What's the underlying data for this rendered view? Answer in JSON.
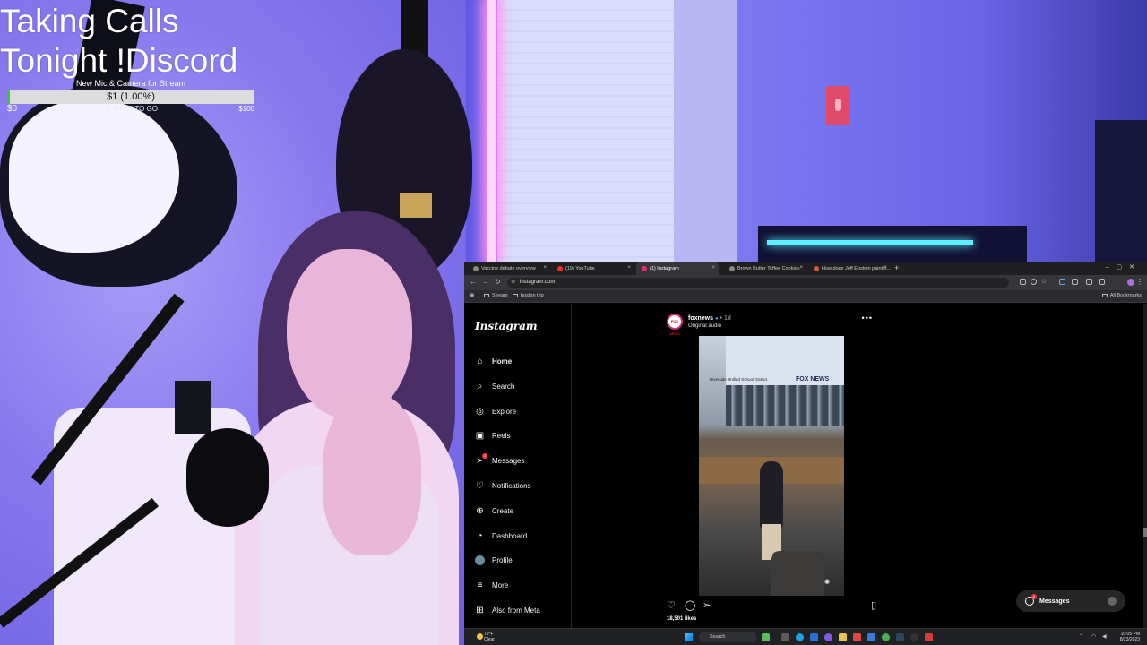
{
  "overlay": {
    "title_line1": "Taking Calls",
    "title_line2": "Tonight !Discord",
    "goal": {
      "label": "New Mic & Camera for Stream",
      "current_text": "$1 (1.00%)",
      "progress_pct": 1.0,
      "start": "$0",
      "days_left": "17 DAYS TO GO",
      "end": "$100",
      "fill_color": "#37c44b"
    }
  },
  "browser": {
    "tabs": [
      {
        "label": "Vaccine debate overview",
        "icon": "globe-icon",
        "active": false
      },
      {
        "label": "(19) YouTube",
        "icon": "youtube-icon",
        "active": false
      },
      {
        "label": "(1) Instagram",
        "icon": "instagram-icon",
        "active": true
      },
      {
        "label": "Brown Butter Toffee Cookies",
        "icon": "globe-icon",
        "active": false
      },
      {
        "label": "How does Jeff Epstein paintin...",
        "icon": "globe-icon",
        "active": false
      }
    ],
    "new_tab": "+",
    "url": "instagram.com",
    "bookmarks": [
      "Stream",
      "boston trip"
    ],
    "all_bookmarks": "All Bookmarks"
  },
  "instagram": {
    "logo": "Instagram",
    "nav": [
      {
        "label": "Home",
        "icon": "home-icon",
        "active": true,
        "badge": ""
      },
      {
        "label": "Search",
        "icon": "search-icon",
        "active": false,
        "badge": ""
      },
      {
        "label": "Explore",
        "icon": "compass-icon",
        "active": false,
        "badge": ""
      },
      {
        "label": "Reels",
        "icon": "reels-icon",
        "active": false,
        "badge": ""
      },
      {
        "label": "Messages",
        "icon": "messenger-icon",
        "active": false,
        "badge": "1"
      },
      {
        "label": "Notifications",
        "icon": "heart-icon",
        "active": false,
        "badge": ""
      },
      {
        "label": "Create",
        "icon": "plus-square-icon",
        "active": false,
        "badge": ""
      },
      {
        "label": "Dashboard",
        "icon": "dashboard-icon",
        "active": false,
        "badge": ""
      },
      {
        "label": "Profile",
        "icon": "profile-avatar-icon",
        "active": false,
        "badge": ""
      },
      {
        "label": "More",
        "icon": "menu-icon",
        "active": false,
        "badge": ""
      },
      {
        "label": "Also from Meta",
        "icon": "meta-icon",
        "active": false,
        "badge": ""
      }
    ],
    "post": {
      "avatar_text": "FOX NEWS",
      "username": "foxnews",
      "verified": "●",
      "time": "• 1d",
      "audio": "Original audio",
      "video_caption": "Riverside Unified School District",
      "video_logo": "FOX NEWS",
      "likes": "18,501 likes"
    },
    "messages_pill": {
      "label": "Messages",
      "badge": "1"
    }
  },
  "taskbar": {
    "weather_temp": "79°F",
    "weather_desc": "Clear",
    "search_placeholder": "Search",
    "time": "10:05 PM",
    "date": "8/23/2023"
  }
}
